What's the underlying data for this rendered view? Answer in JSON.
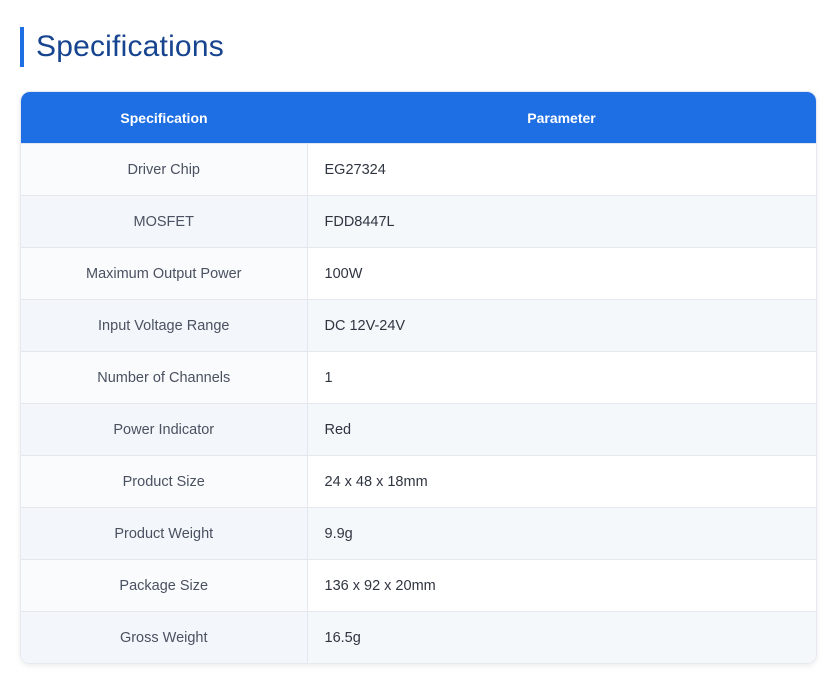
{
  "section": {
    "title": "Specifications"
  },
  "table": {
    "headers": {
      "spec": "Specification",
      "param": "Parameter"
    },
    "rows": [
      {
        "spec": "Driver Chip",
        "param": "EG27324"
      },
      {
        "spec": "MOSFET",
        "param": "FDD8447L"
      },
      {
        "spec": "Maximum Output Power",
        "param": "100W"
      },
      {
        "spec": "Input Voltage Range",
        "param": "DC 12V-24V"
      },
      {
        "spec": "Number of Channels",
        "param": "1"
      },
      {
        "spec": "Power Indicator",
        "param": "Red"
      },
      {
        "spec": "Product Size",
        "param": "24 x 48 x 18mm"
      },
      {
        "spec": "Product Weight",
        "param": "9.9g"
      },
      {
        "spec": "Package Size",
        "param": "136 x 92 x 20mm"
      },
      {
        "spec": "Gross Weight",
        "param": "16.5g"
      }
    ]
  },
  "colors": {
    "accent": "#1e6fe3",
    "heading": "#16448f"
  }
}
